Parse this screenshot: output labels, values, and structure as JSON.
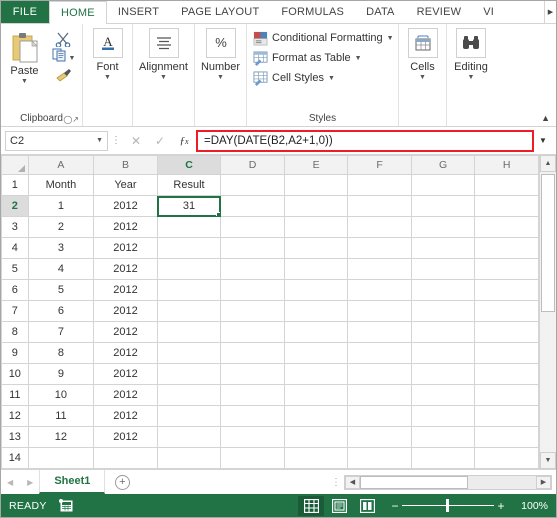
{
  "window": {
    "app": "Microsoft Excel"
  },
  "ribbon": {
    "file_tab": "FILE",
    "tabs": [
      {
        "label": "HOME",
        "active": true
      },
      {
        "label": "INSERT",
        "active": false
      },
      {
        "label": "PAGE LAYOUT",
        "active": false
      },
      {
        "label": "FORMULAS",
        "active": false
      },
      {
        "label": "DATA",
        "active": false
      },
      {
        "label": "REVIEW",
        "active": false
      },
      {
        "label": "VI",
        "active": false
      }
    ],
    "overflow_icon": "chevron-right-icon",
    "groups": {
      "clipboard": {
        "label": "Clipboard",
        "paste_label": "Paste",
        "cut_icon": "scissors-icon",
        "copy_icon": "copy-icon",
        "format_painter_icon": "paintbrush-icon",
        "launcher_icon": "dialog-launcher-icon"
      },
      "font": {
        "label": "Font",
        "icon": "font-letter-a-icon"
      },
      "alignment": {
        "label": "Alignment",
        "icon": "align-lines-icon"
      },
      "number": {
        "label": "Number",
        "icon": "percent-icon"
      },
      "styles": {
        "label": "Styles",
        "items": [
          {
            "label": "Conditional Formatting",
            "icon": "conditional-formatting-icon",
            "has_caret": true
          },
          {
            "label": "Format as Table",
            "icon": "format-as-table-icon",
            "has_caret": true
          },
          {
            "label": "Cell Styles",
            "icon": "cell-styles-icon",
            "has_caret": true
          }
        ]
      },
      "cells": {
        "label": "Cells",
        "icon": "cells-insert-icon"
      },
      "editing": {
        "label": "Editing",
        "icon": "binoculars-icon"
      }
    },
    "collapse_icon": "chevron-up-icon"
  },
  "formula_bar": {
    "name_box_value": "C2",
    "name_box_caret_icon": "chevron-down-icon",
    "cancel_icon": "cancel-x-icon",
    "confirm_icon": "confirm-check-icon",
    "insert_function_icon": "fx-icon",
    "formula": "=DAY(DATE(B2,A2+1,0))",
    "expand_icon": "chevron-down-icon",
    "highlight_color": "#ee1c25"
  },
  "grid": {
    "columns": [
      "A",
      "B",
      "C",
      "D",
      "E",
      "F",
      "G",
      "H"
    ],
    "selected_column": "C",
    "selected_row": 2,
    "selected_cell": "C2",
    "rows": [
      {
        "n": "1",
        "A": "Month",
        "B": "Year",
        "C": "Result",
        "bold": true
      },
      {
        "n": "2",
        "A": "1",
        "B": "2012",
        "C": "31"
      },
      {
        "n": "3",
        "A": "2",
        "B": "2012",
        "C": ""
      },
      {
        "n": "4",
        "A": "3",
        "B": "2012",
        "C": ""
      },
      {
        "n": "5",
        "A": "4",
        "B": "2012",
        "C": ""
      },
      {
        "n": "6",
        "A": "5",
        "B": "2012",
        "C": ""
      },
      {
        "n": "7",
        "A": "6",
        "B": "2012",
        "C": ""
      },
      {
        "n": "8",
        "A": "7",
        "B": "2012",
        "C": ""
      },
      {
        "n": "9",
        "A": "8",
        "B": "2012",
        "C": ""
      },
      {
        "n": "10",
        "A": "9",
        "B": "2012",
        "C": ""
      },
      {
        "n": "11",
        "A": "10",
        "B": "2012",
        "C": ""
      },
      {
        "n": "12",
        "A": "11",
        "B": "2012",
        "C": ""
      },
      {
        "n": "13",
        "A": "12",
        "B": "2012",
        "C": ""
      },
      {
        "n": "14",
        "A": "",
        "B": "",
        "C": ""
      }
    ]
  },
  "sheet_tabs": {
    "prev_icon": "triangle-left-icon",
    "next_icon": "triangle-right-icon",
    "tabs": [
      {
        "label": "Sheet1",
        "active": true
      }
    ],
    "add_label": "+",
    "split_icon": "tab-split-handle-icon",
    "hscroll_left_icon": "triangle-left-icon",
    "hscroll_right_icon": "triangle-right-icon"
  },
  "status_bar": {
    "status": "READY",
    "macro_icon": "record-macro-icon",
    "views": [
      {
        "name": "normal-view",
        "icon": "grid-view-icon",
        "active": true
      },
      {
        "name": "page-layout-view",
        "icon": "page-layout-icon",
        "active": false
      },
      {
        "name": "page-break-view",
        "icon": "page-break-icon",
        "active": false
      }
    ],
    "zoom_out": "−",
    "zoom_in": "+",
    "zoom_level": "100%",
    "accent_color": "#217346"
  }
}
